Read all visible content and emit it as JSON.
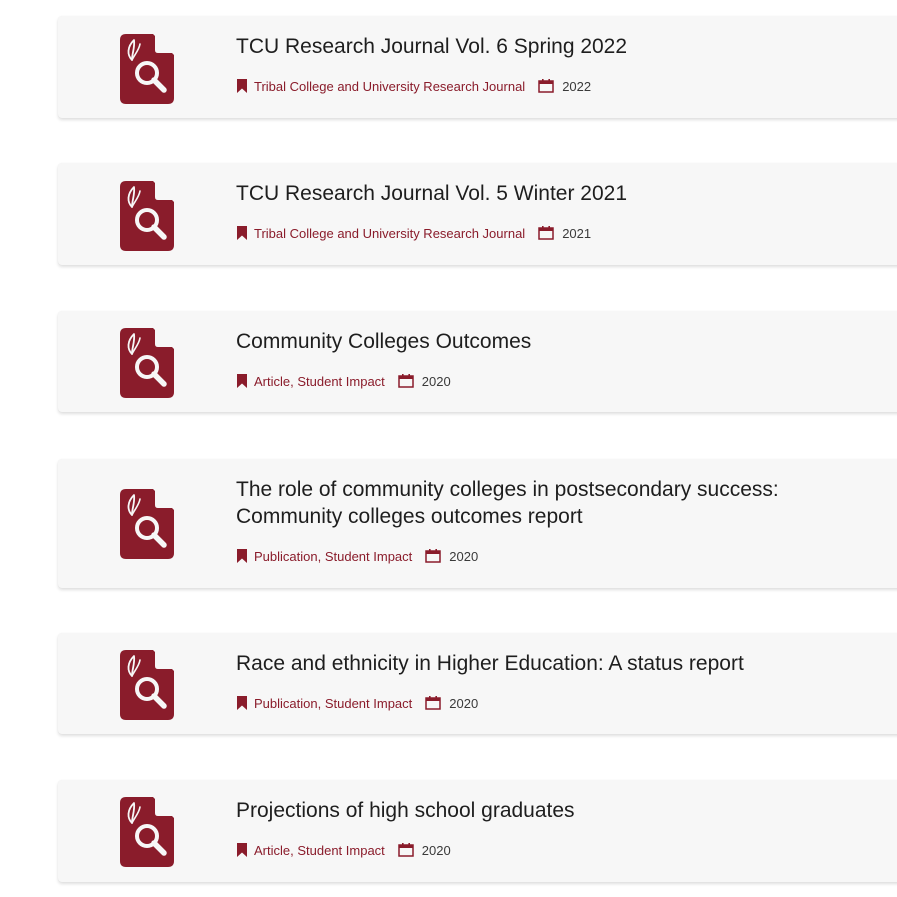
{
  "accent_color": "#8a1c2b",
  "icons": {
    "resource": "document-search-icon",
    "category": "bookmark-icon",
    "date": "calendar-icon"
  },
  "items": [
    {
      "title": "TCU Research Journal Vol. 6 Spring 2022",
      "category": "Tribal College and University Research Journal",
      "year": "2022"
    },
    {
      "title": "TCU Research Journal Vol. 5 Winter 2021",
      "category": "Tribal College and University Research Journal",
      "year": "2021"
    },
    {
      "title": "Community Colleges Outcomes",
      "category": "Article, Student Impact",
      "year": "2020"
    },
    {
      "title": "The role of community colleges in postsecondary success: Community colleges outcomes report",
      "category": "Publication, Student Impact",
      "year": "2020"
    },
    {
      "title": "Race and ethnicity in Higher Education: A status report",
      "category": "Publication, Student Impact",
      "year": "2020"
    },
    {
      "title": "Projections of high school graduates",
      "category": "Article, Student Impact",
      "year": "2020"
    }
  ]
}
